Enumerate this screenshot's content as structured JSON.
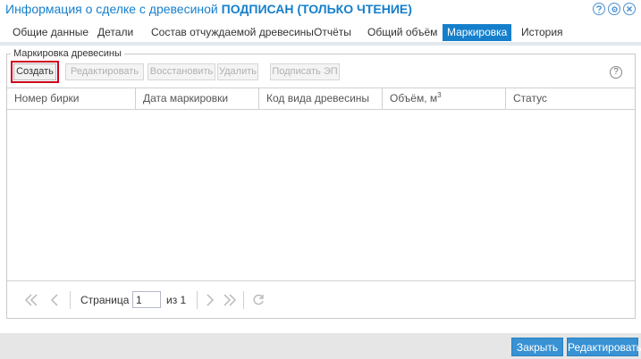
{
  "window": {
    "title_prefix": "Информация о сделке с древесиной",
    "title_status": "ПОДПИСАН (ТОЛЬКО ЧТЕНИЕ)",
    "tools": [
      "help-icon",
      "gear-icon",
      "close-icon"
    ]
  },
  "tabs": [
    {
      "label": "Общие данные",
      "active": false
    },
    {
      "label": "Детали",
      "active": false
    },
    {
      "label": "Состав отчуждаемой древесины",
      "active": false
    },
    {
      "label": "Отчёты",
      "active": false
    },
    {
      "label": "Общий объём",
      "active": false
    },
    {
      "label": "Маркировка",
      "active": true
    },
    {
      "label": "История",
      "active": false
    }
  ],
  "fieldset": {
    "legend": "Маркировка древесины"
  },
  "toolbar": {
    "create": "Создать",
    "edit": "Редактировать",
    "restore": "Восстановить",
    "delete": "Удалить",
    "sign": "Подписать ЭП",
    "help": "?"
  },
  "grid": {
    "columns": [
      "Номер бирки",
      "Дата маркировки",
      "Код вида древесины",
      "Объём, м",
      "Статус"
    ],
    "volume_unit_sup": "3",
    "rows": []
  },
  "pager": {
    "page_label": "Страница",
    "page_value": "1",
    "of_label": "из 1"
  },
  "footer": {
    "close": "Закрыть",
    "edit": "Редактировать"
  },
  "colors": {
    "accent": "#157fcc",
    "highlight": "#d0021b",
    "footer_button": "#3892d4"
  }
}
